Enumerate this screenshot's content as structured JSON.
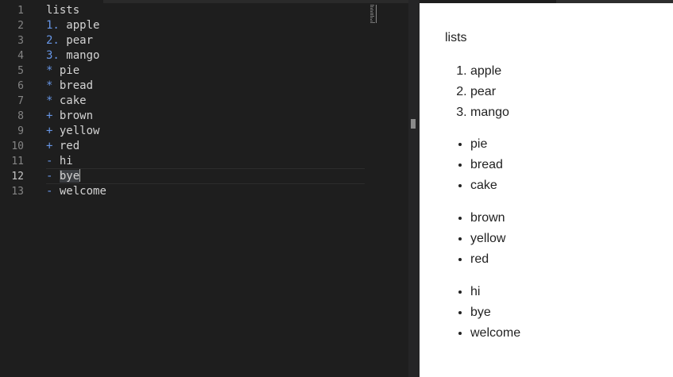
{
  "editor": {
    "line_numbers": [
      "1",
      "2",
      "3",
      "4",
      "5",
      "6",
      "7",
      "8",
      "9",
      "10",
      "11",
      "12",
      "13"
    ],
    "active_line": "12",
    "lines": [
      {
        "marker": "",
        "text": "lists"
      },
      {
        "marker": "1.",
        "text": "apple"
      },
      {
        "marker": "2.",
        "text": "pear"
      },
      {
        "marker": "3.",
        "text": "mango"
      },
      {
        "marker": "*",
        "text": "pie"
      },
      {
        "marker": "*",
        "text": "bread"
      },
      {
        "marker": "*",
        "text": "cake"
      },
      {
        "marker": "+",
        "text": "brown"
      },
      {
        "marker": "+",
        "text": "yellow"
      },
      {
        "marker": "+",
        "text": "red"
      },
      {
        "marker": "-",
        "text": "hi"
      },
      {
        "marker": "-",
        "text": "bye"
      },
      {
        "marker": "-",
        "text": "welcome"
      }
    ]
  },
  "preview": {
    "title": "lists",
    "ordered": [
      "apple",
      "pear",
      "mango"
    ],
    "bullets_a": [
      "pie",
      "bread",
      "cake"
    ],
    "bullets_b": [
      "brown",
      "yellow",
      "red"
    ],
    "bullets_c": [
      "hi",
      "bye",
      "welcome"
    ]
  },
  "colors": {
    "editor_bg": "#1e1e1e",
    "marker": "#6796e6",
    "text": "#d4d4d4",
    "preview_bg": "#ffffff"
  }
}
